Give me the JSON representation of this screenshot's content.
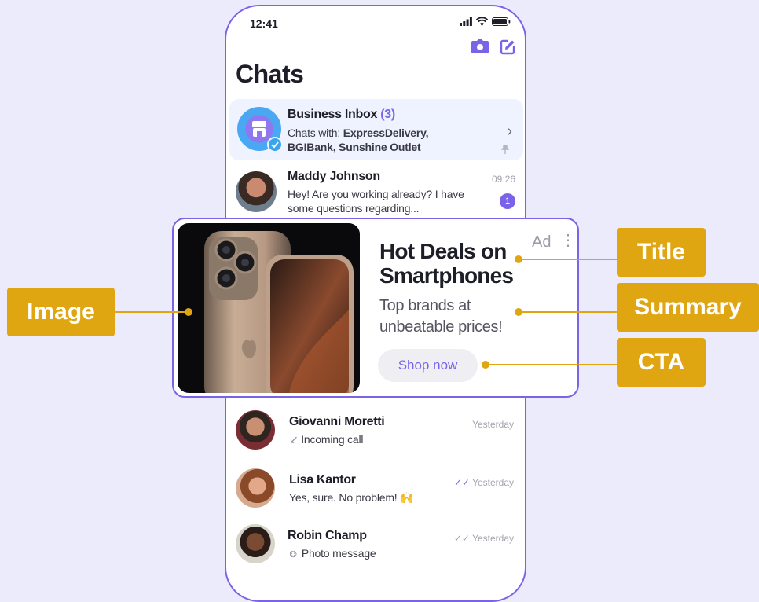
{
  "status_bar": {
    "time": "12:41"
  },
  "header": {
    "title": "Chats",
    "icons": [
      "camera-icon",
      "compose-icon"
    ]
  },
  "business_inbox": {
    "name": "Business Inbox",
    "count": "(3)",
    "prefix": "Chats with: ",
    "chats_line1": "ExpressDelivery,",
    "chats_line2": "BGIBank, Sunshine Outlet"
  },
  "chats": [
    {
      "name": "Maddy Johnson",
      "message_line1": "Hey! Are you working already? I have",
      "message_line2": "some questions regarding...",
      "time": "09:26",
      "unread": "1"
    },
    {
      "name": "Giovanni Moretti",
      "message": "Incoming call",
      "time": "Yesterday"
    },
    {
      "name": "Lisa Kantor",
      "message": "Yes, sure. No problem! 🙌",
      "time": "Yesterday"
    },
    {
      "name": "Robin Champ",
      "message": "Photo message",
      "time": "Yesterday"
    }
  ],
  "ad": {
    "label": "Ad",
    "title_line1": "Hot Deals on",
    "title_line2": "Smartphones",
    "summary_line1": "Top brands at",
    "summary_line2": "unbeatable prices!",
    "cta": "Shop now"
  },
  "callouts": {
    "image": "Image",
    "title": "Title",
    "summary": "Summary",
    "cta": "CTA"
  },
  "colors": {
    "accent": "#7b63e8",
    "callout": "#e0a612",
    "background": "#ecebfb",
    "blue_check": "#3aa4ee"
  }
}
